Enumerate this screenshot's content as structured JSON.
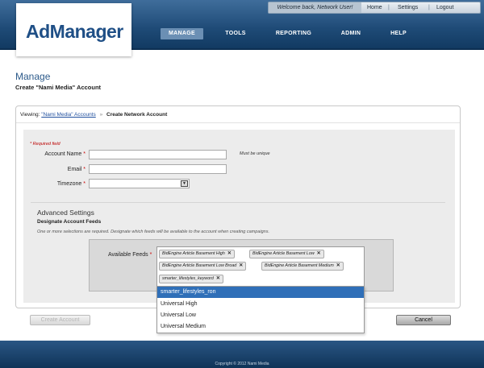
{
  "app": {
    "logo": "AdManager"
  },
  "topbar": {
    "welcome": "Welcome back, Network User!",
    "links": [
      "Home",
      "Settings",
      "Logout"
    ],
    "separator": "|"
  },
  "nav": {
    "items": [
      "MANAGE",
      "TOOLS",
      "REPORTING",
      "ADMIN",
      "HELP"
    ],
    "active": "MANAGE"
  },
  "page": {
    "title": "Manage",
    "subtitle": "Create \"Nami Media\" Account"
  },
  "breadcrumb": {
    "prefix": "Viewing:",
    "link": "\"Nami Media\" Accounts",
    "arrow": "»",
    "current": "Create Network Account"
  },
  "form": {
    "required_note": "* Required field",
    "star": "*",
    "account_name": {
      "label": "Account Name",
      "value": "",
      "hint": "Must be unique"
    },
    "email": {
      "label": "Email",
      "value": ""
    },
    "timezone": {
      "label": "Timezone",
      "value": "",
      "arrow": "▼"
    }
  },
  "advanced": {
    "title": "Advanced Settings",
    "feeds_heading": "Designate Account Feeds",
    "note": "One or more selections are required. Designate which feeds will be available to the account when creating campaigns.",
    "available_label": "Available Feeds",
    "remove_glyph": "✕",
    "selected": [
      "BidEngine Article Basement High",
      "BidEngine Article Basement Low",
      "BidEngine Article Basement Low Broad",
      "BidEngine Article Basement Medium",
      "smarter_lifestyles_keyword"
    ],
    "options": [
      "smarter_lifestyles_ron",
      "Universal High",
      "Universal Low",
      "Universal Medium"
    ],
    "highlighted_option": "smarter_lifestyles_ron"
  },
  "buttons": {
    "create": "Create Account",
    "cancel": "Cancel"
  },
  "footer": {
    "text": "Copyright © 2012 Nami Media"
  },
  "colors": {
    "header": "#1e4a76",
    "accent": "#2c5a8a",
    "highlight": "#2f6fb8",
    "required": "#cc0000"
  }
}
